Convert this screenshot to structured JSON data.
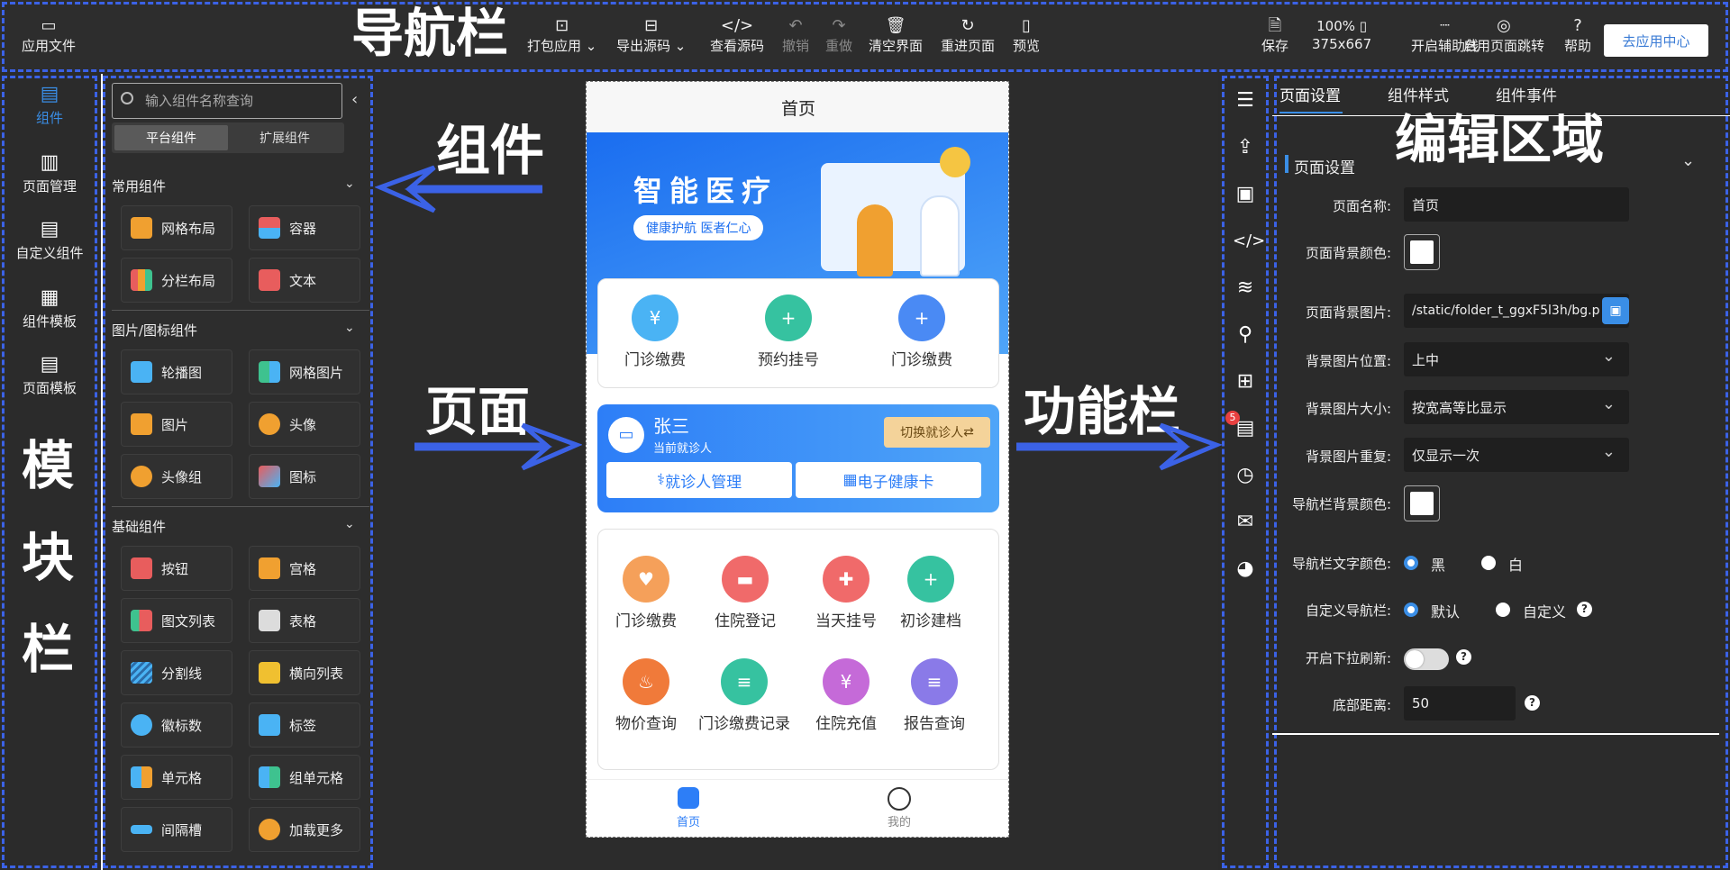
{
  "topbar": {
    "app_file": "应用文件",
    "overlay": "导航栏",
    "pack": "打包应用",
    "export": "导出源码",
    "view_source": "查看源码",
    "undo": "撤销",
    "redo": "重做",
    "clear": "清空界面",
    "reload": "重进页面",
    "preview": "预览",
    "save": "保存",
    "zoom": "100%",
    "size": "375x667",
    "guides": "开启辅助线",
    "jump": "启用页面跳转",
    "help": "帮助",
    "to_app_center": "去应用中心"
  },
  "modbar": {
    "items": [
      "组件",
      "页面管理",
      "自定义组件",
      "组件模板",
      "页面模板"
    ],
    "overlay": [
      "模",
      "块",
      "栏"
    ]
  },
  "components": {
    "search_placeholder": "输入组件名称查询",
    "tabs": [
      "平台组件",
      "扩展组件"
    ],
    "overlay": "组件",
    "sections": [
      {
        "title": "常用组件",
        "items": [
          "网格布局",
          "容器",
          "分栏布局",
          "文本"
        ]
      },
      {
        "title": "图片/图标组件",
        "items": [
          "轮播图",
          "网格图片",
          "图片",
          "头像",
          "头像组",
          "图标"
        ]
      },
      {
        "title": "基础组件",
        "items": [
          "按钮",
          "宫格",
          "图文列表",
          "表格",
          "分割线",
          "横向列表",
          "徽标数",
          "标签",
          "单元格",
          "组单元格",
          "间隔槽",
          "加载更多"
        ]
      }
    ]
  },
  "canvas": {
    "overlay_page": "页面",
    "overlay_func": "功能栏"
  },
  "phone": {
    "title": "首页",
    "banner_title": "智能医疗",
    "banner_slogan": "健康护航 医者仁心",
    "grid1": [
      "门诊缴费",
      "预约挂号",
      "门诊缴费"
    ],
    "patient_name": "张三",
    "patient_sub": "当前就诊人",
    "switch": "切换就诊人",
    "manage": "就诊人管理",
    "health_card": "电子健康卡",
    "grid2": [
      "门诊缴费",
      "住院登记",
      "当天挂号",
      "初诊建档",
      "物价查询",
      "门诊缴费记录",
      "住院充值",
      "报告查询"
    ],
    "tabbar": [
      "首页",
      "我的"
    ]
  },
  "funcbar": {
    "badge": "5"
  },
  "editor": {
    "tabs": [
      "页面设置",
      "组件样式",
      "组件事件"
    ],
    "overlay": "编辑区域",
    "section": "页面设置",
    "labels": {
      "name": "页面名称:",
      "bg_color": "页面背景颜色:",
      "bg_image": "页面背景图片:",
      "bg_pos": "背景图片位置:",
      "bg_size": "背景图片大小:",
      "bg_repeat": "背景图片重复:",
      "nav_bg": "导航栏背景颜色:",
      "nav_text": "导航栏文字颜色:",
      "custom_nav": "自定义导航栏:",
      "pull_refresh": "开启下拉刷新:",
      "bottom": "底部距离:"
    },
    "values": {
      "name": "首页",
      "bg_image": "/static/folder_t_ggxF5l3h/bg.p",
      "bg_pos": "上中",
      "bg_size": "按宽高等比显示",
      "bg_repeat": "仅显示一次",
      "nav_black": "黑",
      "nav_white": "白",
      "custom_default": "默认",
      "custom_custom": "自定义",
      "bottom": "50"
    }
  }
}
